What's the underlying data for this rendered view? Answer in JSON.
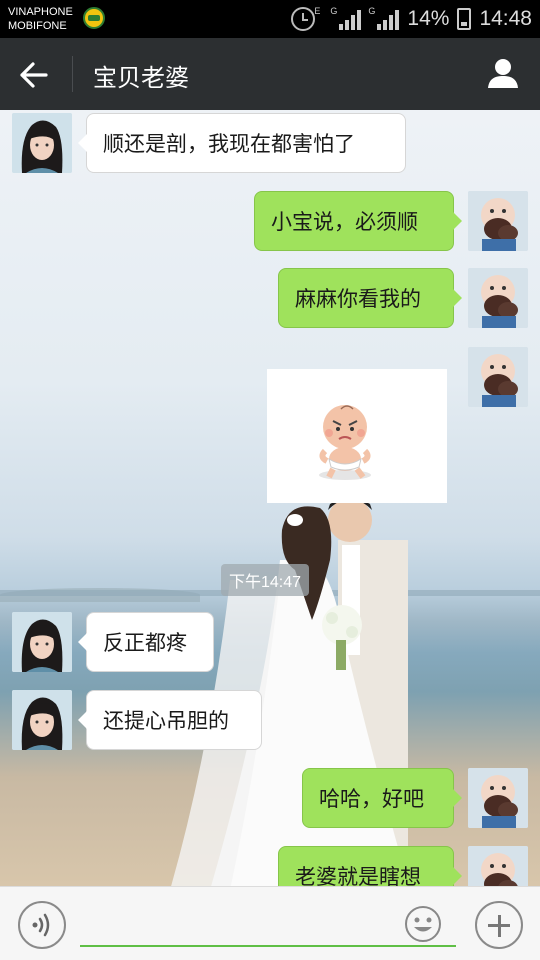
{
  "status_bar": {
    "carrier_1": "VINAPHONE",
    "carrier_2": "MOBIFONE",
    "battery": "14%",
    "time": "14:48",
    "network_1": "E",
    "network_2": "G",
    "network_3": "G"
  },
  "header": {
    "title": "宝贝老婆",
    "back_icon": "arrow-left-icon",
    "profile_icon": "person-icon",
    "background": "#2c2f31"
  },
  "messages": [
    {
      "side": "in",
      "text": "顺还是剖，我现在都害怕了"
    },
    {
      "side": "out",
      "text": "小宝说，必须顺"
    },
    {
      "side": "out",
      "text": "麻麻你看我的"
    },
    {
      "side": "out",
      "type": "sticker",
      "sticker_icon": "angry-baby-sticker"
    },
    {
      "side": "in",
      "text": "反正都疼"
    },
    {
      "side": "in",
      "text": "还提心吊胆的"
    },
    {
      "side": "out",
      "text": "哈哈，好吧"
    },
    {
      "side": "out",
      "text": "老婆就是瞎想"
    }
  ],
  "timestamp": "下午14:47",
  "input_bar": {
    "placeholder": "",
    "value": "",
    "voice_icon": "voice-icon",
    "emoji_icon": "smiley-icon",
    "plus_icon": "plus-icon"
  },
  "colors": {
    "outgoing_bubble": "#9fe25c",
    "incoming_bubble": "#ffffff",
    "accent_line": "#5fbf45"
  }
}
